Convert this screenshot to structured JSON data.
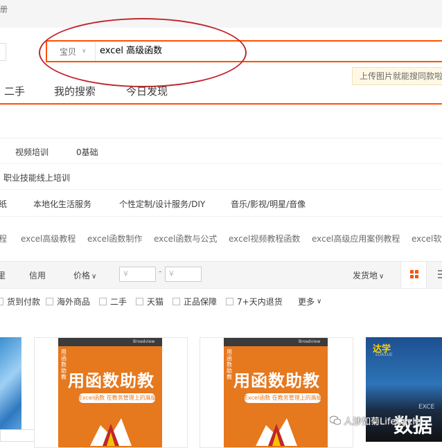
{
  "topbar": {
    "text": "册"
  },
  "search": {
    "category": "宝贝",
    "query": "excel 高级函数",
    "upload_tip": "上传图片就能搜同款啦"
  },
  "nav": {
    "tabs": [
      "二手",
      "我的搜索",
      "今日发现"
    ]
  },
  "categories": {
    "row1": [
      "视频培训",
      "0基础"
    ],
    "row2": [
      "职业技能线上培训"
    ],
    "row3": [
      "纸",
      "本地化生活服务",
      "个性定制/设计服务/DIY",
      "音乐/影视/明星/音像"
    ]
  },
  "related": [
    "程",
    "excel高级教程",
    "excel函数制作",
    "excel函数与公式",
    "excel视频教程函数",
    "excel高级应用案例教程",
    "excel软件"
  ],
  "sortbar": {
    "credit": "信用",
    "price": "价格",
    "price_min_placeholder": "¥",
    "price_max_placeholder": "¥",
    "dash": "-",
    "ship_from": "发货地",
    "filters": [
      "货到付款",
      "海外商品",
      "二手",
      "天猫",
      "正品保障",
      "7+天内退货",
      "更多"
    ]
  },
  "products": [
    {
      "title": "用函数助教",
      "subtitle": "Excel函数 在教务管理上的高级应用",
      "side": "用函数助教",
      "publisher": "Broadview"
    },
    {
      "title": "用函数助教",
      "subtitle": "Excel函数 在教务管理上的高级应用",
      "side": "用函数助教",
      "publisher": "Broadview"
    },
    {
      "logo": "达学",
      "sub": "EDAXUE",
      "title": "数据",
      "extra": "EXCE"
    }
  ],
  "watermark": "人涉如菊LifeCycle",
  "colors": {
    "accent": "#ff5000",
    "annotation": "#c0262d",
    "book": "#e6781e"
  }
}
